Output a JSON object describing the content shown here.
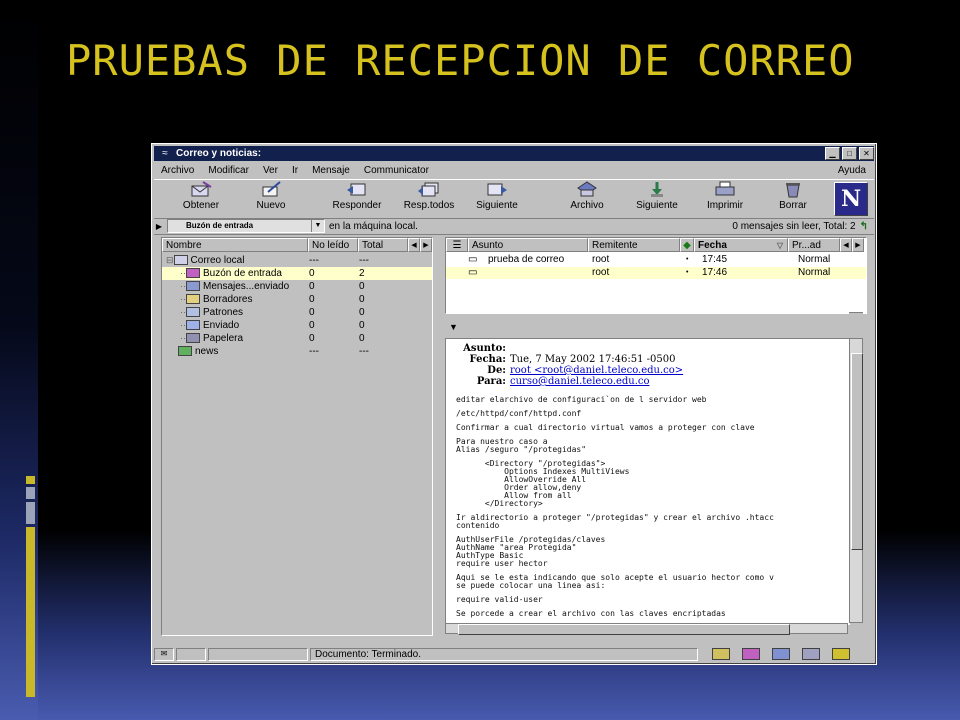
{
  "slide": {
    "title": "PRUEBAS DE RECEPCION DE CORREO",
    "title_color": "#d6c21f"
  },
  "window": {
    "title": "Correo y noticias:",
    "controls": [
      "minimize",
      "maximize",
      "close"
    ]
  },
  "menubar": {
    "items": [
      "Archivo",
      "Modificar",
      "Ver",
      "Ir",
      "Mensaje",
      "Communicator"
    ],
    "help": "Ayuda"
  },
  "toolbar": {
    "buttons": [
      {
        "label": "Obtener",
        "icon": "get-mail-icon"
      },
      {
        "label": "Nuevo",
        "icon": "new-msg-icon"
      },
      {
        "label": "Responder",
        "icon": "reply-icon"
      },
      {
        "label": "Resp.todos",
        "icon": "reply-all-icon"
      },
      {
        "label": "Siguiente",
        "icon": "forward-icon"
      },
      {
        "label": "Archivo",
        "icon": "file-icon"
      },
      {
        "label": "Siguiente",
        "icon": "next-icon"
      },
      {
        "label": "Imprimir",
        "icon": "print-icon"
      },
      {
        "label": "Borrar",
        "icon": "delete-icon"
      }
    ],
    "brand": "N"
  },
  "locbar": {
    "folder": "Buzón de entrada",
    "location": "en la máquina local.",
    "counts": "0 mensajes sin leer, Total: 2"
  },
  "folders": {
    "headers": {
      "name": "Nombre",
      "unread": "No leído",
      "total": "Total"
    },
    "items": [
      {
        "name": "Correo local",
        "unread": "---",
        "total": "---",
        "level": 0
      },
      {
        "name": "Buzón de entrada",
        "unread": "0",
        "total": "2",
        "level": 1
      },
      {
        "name": "Mensajes...enviado",
        "unread": "0",
        "total": "0",
        "level": 1
      },
      {
        "name": "Borradores",
        "unread": "0",
        "total": "0",
        "level": 1
      },
      {
        "name": "Patrones",
        "unread": "0",
        "total": "0",
        "level": 1
      },
      {
        "name": "Enviado",
        "unread": "0",
        "total": "0",
        "level": 1
      },
      {
        "name": "Papelera",
        "unread": "0",
        "total": "0",
        "level": 1
      },
      {
        "name": "news",
        "unread": "---",
        "total": "---",
        "level": 0
      }
    ]
  },
  "messages": {
    "headers": {
      "subject": "Asunto",
      "sender": "Remitente",
      "date": "Fecha",
      "priority": "Pr...ad"
    },
    "rows": [
      {
        "subject": "prueba de correo",
        "sender": "root",
        "date": "17:45",
        "priority": "Normal"
      },
      {
        "subject": "",
        "sender": "root",
        "date": "17:46",
        "priority": "Normal"
      }
    ]
  },
  "message": {
    "labels": {
      "subject": "Asunto:",
      "date": "Fecha:",
      "from": "De:",
      "to": "Para:"
    },
    "date": "Tue, 7 May 2002 17:46:51 -0500",
    "from": "root <root@daniel.teleco.edu.co>",
    "to": "curso@daniel.teleco.edu.co",
    "body": [
      "editar elarchivo de configuraci`on de l servidor web",
      "",
      "/etc/httpd/conf/httpd.conf",
      "",
      "Confirmar a cual directorio virtual vamos a proteger con clave",
      "",
      "Para nuestro caso a",
      "Alias /seguro \"/protegidas\"",
      "",
      "      <Directory \"/protegidas\">",
      "          Options Indexes MultiViews",
      "          AllowOverride All",
      "          Order allow,deny",
      "          Allow from all",
      "      </Directory>",
      "",
      "Ir aldirectorio a proteger \"/protegidas\" y crear el archivo .htacc",
      "contenido",
      "",
      "AuthUserFile /protegidas/claves",
      "AuthName \"area Protegida\"",
      "AuthType Basic",
      "require user hector",
      "",
      "Aqui se le esta indicando que solo acepte el usuario hector como v",
      "se puede colocar una linea asi:",
      "",
      "require valid-user",
      "",
      "Se porcede a crear el archivo con las claves encriptadas"
    ]
  },
  "statusbar": {
    "text": "Documento: Terminado."
  }
}
